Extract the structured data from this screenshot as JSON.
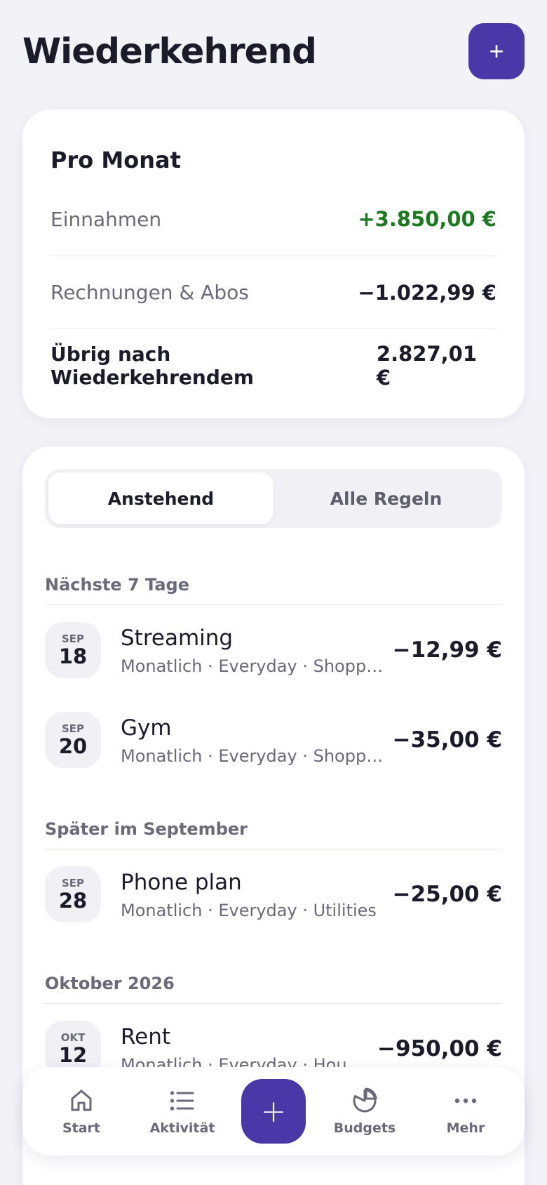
{
  "header": {
    "title": "Wiederkehrend",
    "add_label": "+"
  },
  "summary": {
    "title": "Pro Monat",
    "rows": [
      {
        "label": "Einnahmen",
        "value": "+3.850,00 €",
        "tone": "positive"
      },
      {
        "label": "Rechnungen & Abos",
        "value": "−1.022,99 €",
        "tone": "neutral"
      },
      {
        "label": "Übrig nach Wiederkehrendem",
        "value": "2.827,01 €",
        "tone": "total"
      }
    ]
  },
  "tabs": {
    "upcoming": "Anstehend",
    "all_rules": "Alle Regeln",
    "active": "upcoming"
  },
  "sections": [
    {
      "label": "Nächste 7 Tage",
      "items": [
        {
          "month": "SEP",
          "day": "18",
          "name": "Streaming",
          "meta": "Monatlich · Everyday · Shopping",
          "amount": "−12,99 €"
        },
        {
          "month": "SEP",
          "day": "20",
          "name": "Gym",
          "meta": "Monatlich · Everyday · Shopping",
          "amount": "−35,00 €"
        }
      ]
    },
    {
      "label": "Später im September",
      "items": [
        {
          "month": "SEP",
          "day": "28",
          "name": "Phone plan",
          "meta": "Monatlich · Everyday · Utilities",
          "amount": "−25,00 €"
        }
      ]
    },
    {
      "label": "Oktober 2026",
      "items": [
        {
          "month": "OKT",
          "day": "12",
          "name": "Rent",
          "meta": "Monatlich · Everyday · Housi...",
          "amount": "−950,00 €"
        }
      ]
    }
  ],
  "nav": {
    "start": "Start",
    "activity": "Aktivität",
    "fab": "+",
    "budgets": "Budgets",
    "more": "Mehr"
  },
  "colors": {
    "accent": "#4a38a8",
    "positive": "#1a7a1e",
    "background": "#f2f2f7"
  },
  "icons": {
    "start": "home-icon",
    "activity": "list-icon",
    "budgets": "pie-chart-icon",
    "more": "more-dots-icon"
  }
}
